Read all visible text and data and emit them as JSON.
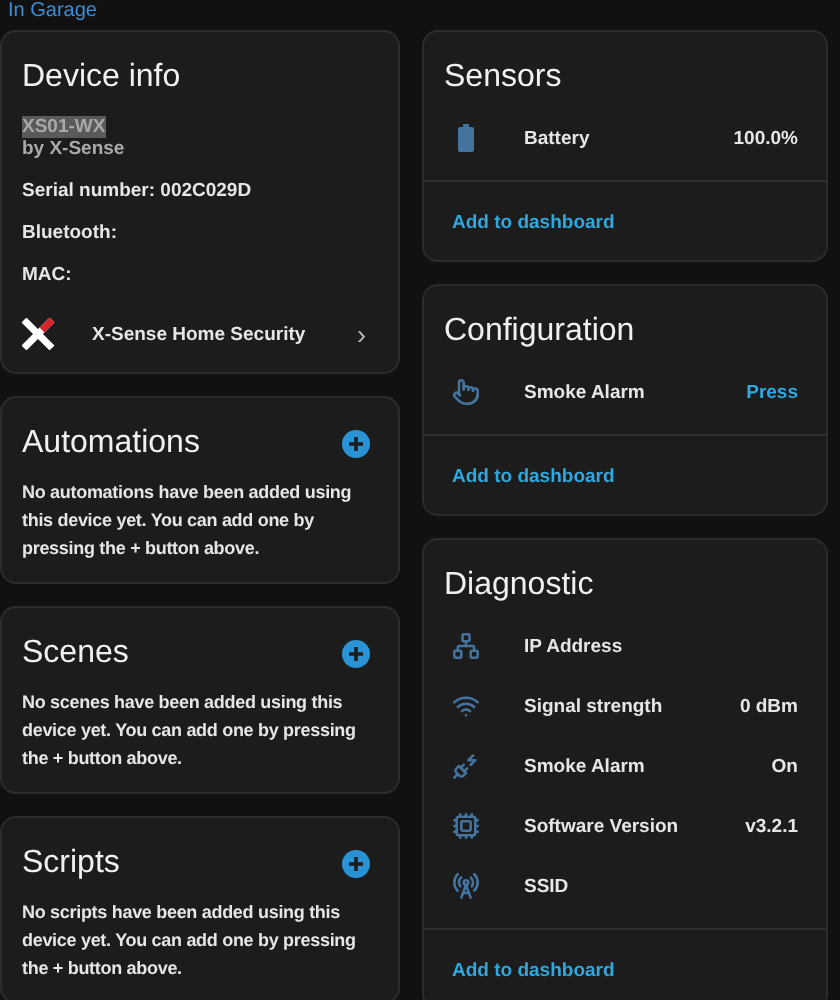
{
  "breadcrumb": "In Garage",
  "device_info": {
    "title": "Device info",
    "model": "XS01-WX",
    "model_highlighted": true,
    "manufacturer": "by X-Sense",
    "details": [
      "Serial number: 002C029D",
      "Bluetooth:",
      "MAC:"
    ],
    "integration": "X-Sense Home Security",
    "chevron": "›"
  },
  "sections": [
    {
      "title": "Automations",
      "message": "No automations have been added using this device yet. You can add one by pressing the + button above."
    },
    {
      "title": "Scenes",
      "message": "No scenes have been added using this device yet. You can add one by pressing the + button above."
    },
    {
      "title": "Scripts",
      "message": "No scripts have been added using this device yet. You can add one by pressing the + button above."
    }
  ],
  "entity_cards": [
    {
      "title": "Sensors",
      "link": "Add to dashboard",
      "entities": [
        {
          "kind": "value",
          "name": "Battery",
          "value": "100.0%"
        }
      ]
    },
    {
      "title": "Configuration",
      "link": "Add to dashboard",
      "entities": [
        {
          "kind": "action",
          "name": "Smoke Alarm",
          "value": "Press"
        }
      ]
    },
    {
      "title": "Diagnostic",
      "link": "Add to dashboard",
      "entities": [
        {
          "kind": "value",
          "name": "IP Address"
        },
        {
          "kind": "value",
          "name": "Signal strength",
          "value": "0 dBm"
        },
        {
          "kind": "value",
          "name": "Smoke Alarm",
          "value": "On"
        },
        {
          "kind": "value",
          "name": "Software Version",
          "value": "v3.2.1"
        },
        {
          "kind": "value",
          "name": "SSID"
        }
      ]
    }
  ]
}
